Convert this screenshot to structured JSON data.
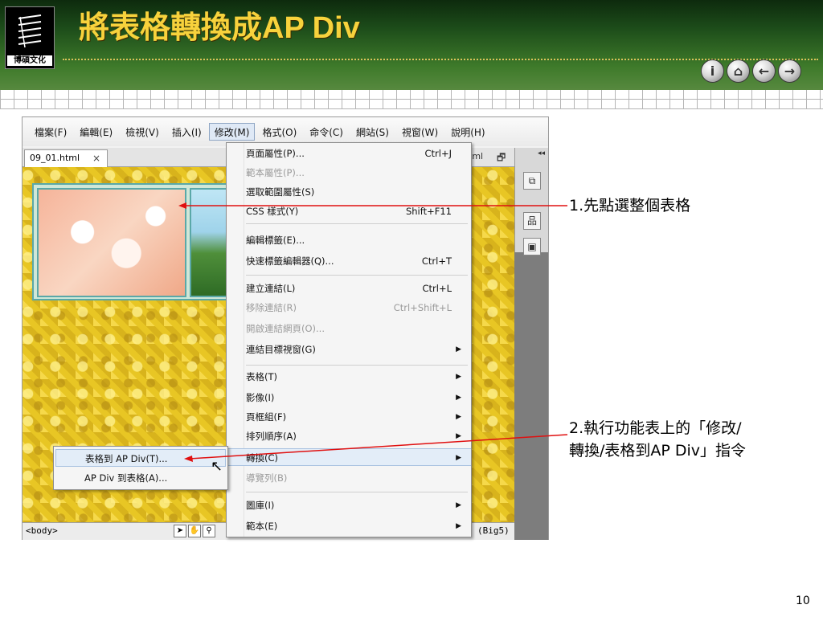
{
  "slide": {
    "title": "將表格轉換成AP Div",
    "logo_text": "博碩文化",
    "page_number": "10",
    "nav_buttons": [
      {
        "icon": "info-icon",
        "glyph": "i"
      },
      {
        "icon": "home-icon",
        "glyph": "⌂"
      },
      {
        "icon": "back-arrow-icon",
        "glyph": "←"
      },
      {
        "icon": "forward-arrow-icon",
        "glyph": "→"
      }
    ]
  },
  "app": {
    "menubar": [
      "檔案(F)",
      "編輯(E)",
      "檢視(V)",
      "插入(I)",
      "修改(M)",
      "格式(O)",
      "命令(C)",
      "網站(S)",
      "視窗(W)",
      "說明(H)"
    ],
    "active_menu": "修改(M)",
    "doc_tab": {
      "name": "09_01.html",
      "close": "×"
    },
    "tab_right_label": "tml",
    "status": {
      "tag": "<body>",
      "encoding": "(Big5)"
    }
  },
  "modify_menu": {
    "items": [
      {
        "label": "頁面屬性(P)...",
        "shortcut": "Ctrl+J"
      },
      {
        "label": "範本屬性(P)...",
        "shortcut": "",
        "disabled": true
      },
      {
        "label": "選取範圍屬性(S)",
        "shortcut": ""
      },
      {
        "label": "CSS 樣式(Y)",
        "shortcut": "Shift+F11"
      },
      {
        "label": "編輯標籤(E)...",
        "shortcut": ""
      },
      {
        "label": "快速標籤編輯器(Q)...",
        "shortcut": "Ctrl+T"
      },
      {
        "label": "建立連結(L)",
        "shortcut": "Ctrl+L"
      },
      {
        "label": "移除連結(R)",
        "shortcut": "Ctrl+Shift+L",
        "disabled": true
      },
      {
        "label": "開啟連結網頁(O)...",
        "shortcut": "",
        "disabled": true
      },
      {
        "label": "連結目標視窗(G)",
        "submenu": true
      },
      {
        "label": "表格(T)",
        "submenu": true
      },
      {
        "label": "影像(I)",
        "submenu": true
      },
      {
        "label": "頁框組(F)",
        "submenu": true
      },
      {
        "label": "排列順序(A)",
        "submenu": true
      },
      {
        "label": "轉換(C)",
        "submenu": true,
        "highlighted": true
      },
      {
        "label": "導覽列(B)",
        "disabled": true
      },
      {
        "label": "圖庫(I)",
        "submenu": true
      },
      {
        "label": "範本(E)",
        "submenu": true
      }
    ]
  },
  "convert_submenu": {
    "items": [
      {
        "label": "表格到 AP Div(T)...",
        "highlighted": true
      },
      {
        "label": "AP Div 到表格(A)..."
      }
    ]
  },
  "callouts": {
    "step1": "1.先點選整個表格",
    "step2_line1": "2.執行功能表上的「修改/",
    "step2_line2": "轉換/表格到AP Div」指令"
  }
}
